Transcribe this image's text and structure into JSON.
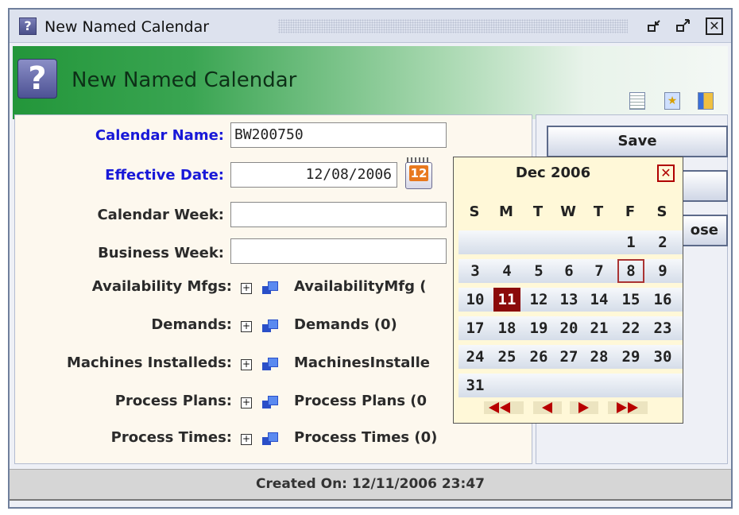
{
  "window": {
    "title": "New Named Calendar",
    "minimize_glyph": "▫",
    "maximize_glyph": "▫",
    "close_glyph": "✕"
  },
  "header": {
    "title": "New Named Calendar",
    "icon": "help-icon",
    "help_glyph": "?",
    "tools": [
      "document-icon",
      "favorite-icon",
      "layout-icon"
    ]
  },
  "form": {
    "calendar_name": {
      "label": "Calendar Name:",
      "value": "BW200750"
    },
    "effective_date": {
      "label": "Effective Date:",
      "value": "12/08/2006"
    },
    "calendar_week": {
      "label": "Calendar Week:",
      "value": ""
    },
    "business_week": {
      "label": "Business Week:",
      "value": ""
    },
    "relations": [
      {
        "label": "Availability Mfgs:",
        "node": "AvailabilityMfg ("
      },
      {
        "label": "Demands:",
        "node": "Demands (0)"
      },
      {
        "label": "Machines Installeds:",
        "node": "MachinesInstalle"
      },
      {
        "label": "Process Plans:",
        "node": "Process Plans (0"
      },
      {
        "label": "Process Times:",
        "node": "Process Times (0)"
      }
    ],
    "expand_glyph": "+",
    "calendar_icon_number": "12"
  },
  "buttons": {
    "save": "Save",
    "middle": "",
    "close_partial": "ose"
  },
  "status": {
    "created_on": "Created On: 12/11/2006 23:47"
  },
  "calendar_popup": {
    "month_label": "Dec 2006",
    "close_glyph": "✕",
    "weekdays": [
      "S",
      "M",
      "T",
      "W",
      "T",
      "F",
      "S"
    ],
    "weeks": [
      [
        "",
        "",
        "",
        "",
        "",
        "1",
        "2"
      ],
      [
        "3",
        "4",
        "5",
        "6",
        "7",
        "8",
        "9"
      ],
      [
        "10",
        "11",
        "12",
        "13",
        "14",
        "15",
        "16"
      ],
      [
        "17",
        "18",
        "19",
        "20",
        "21",
        "22",
        "23"
      ],
      [
        "24",
        "25",
        "26",
        "27",
        "28",
        "29",
        "30"
      ],
      [
        "31",
        "",
        "",
        "",
        "",
        "",
        ""
      ]
    ],
    "today": "11",
    "selected": "8",
    "today_color": "#8b0a0a",
    "nav_color": "#b80000"
  }
}
